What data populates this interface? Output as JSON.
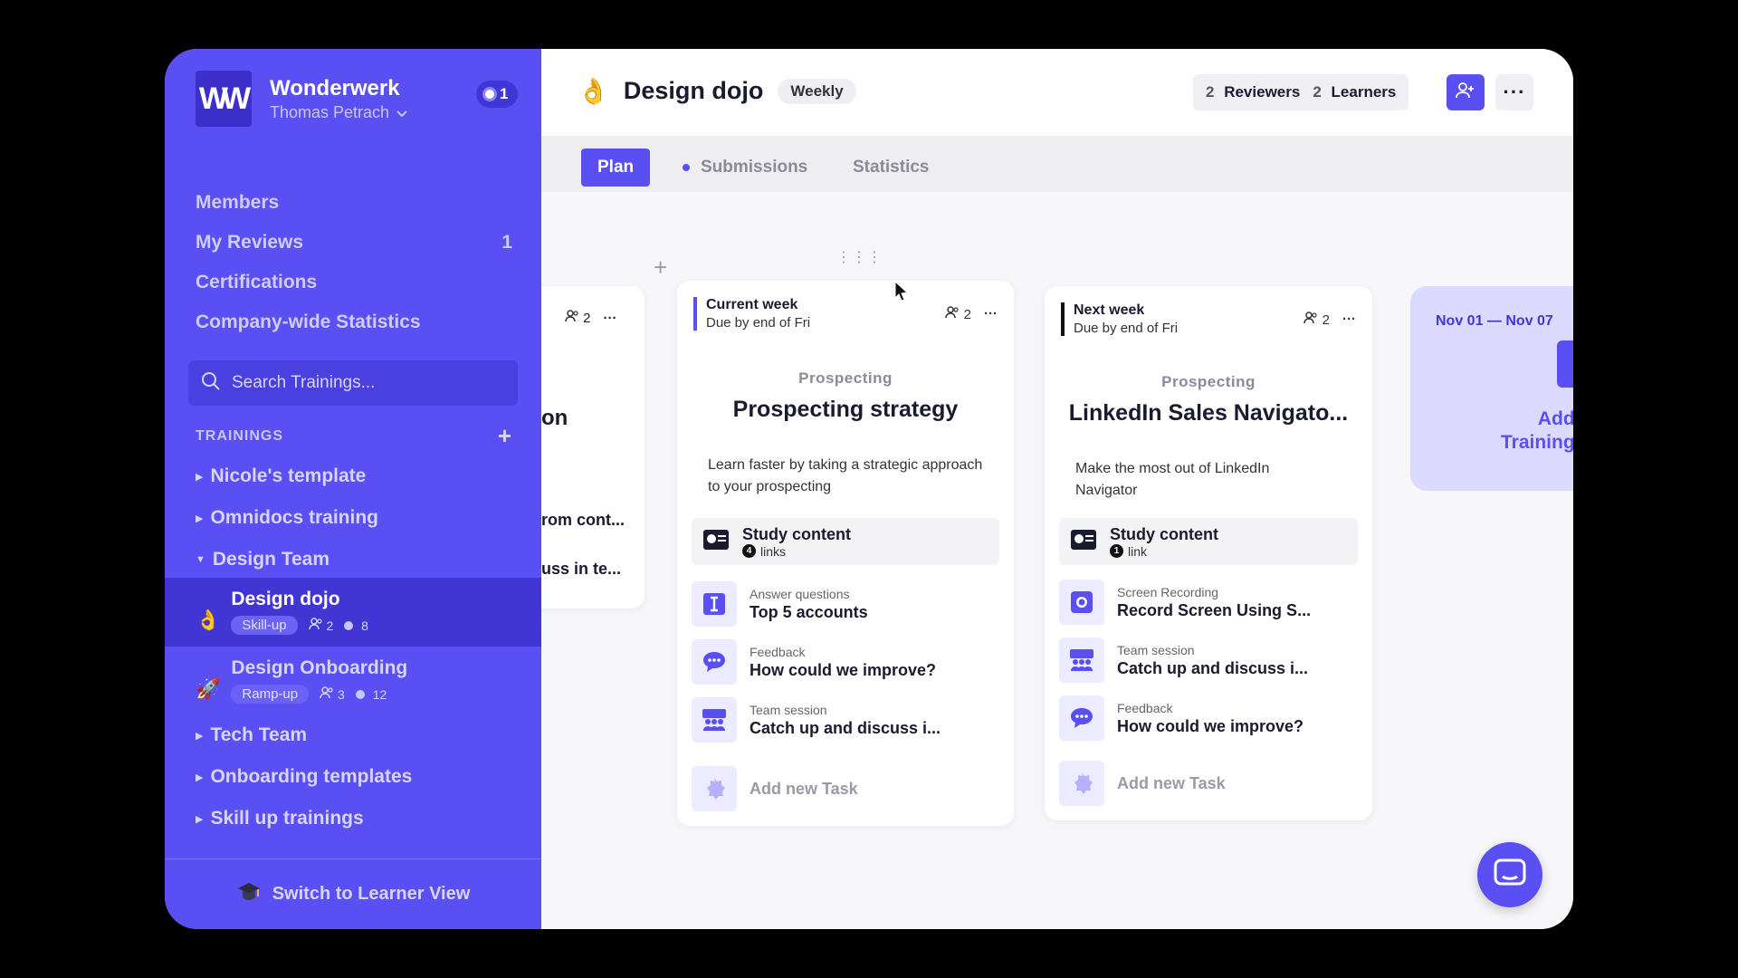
{
  "sidebar": {
    "logo_text": "W",
    "org_name": "Wonderwerk",
    "user_name": "Thomas Petrach",
    "notification_count": "1",
    "nav": [
      {
        "label": "Members",
        "count": ""
      },
      {
        "label": "My Reviews",
        "count": "1"
      },
      {
        "label": "Certifications",
        "count": ""
      },
      {
        "label": "Company-wide Statistics",
        "count": ""
      }
    ],
    "search_placeholder": "Search Trainings...",
    "trainings_header": "TRAININGS",
    "tree": {
      "nicole": "Nicole's template",
      "omnidocs": "Omnidocs training",
      "design_team": "Design Team",
      "tech_team": "Tech Team",
      "onboarding": "Onboarding templates",
      "skillup": "Skill up trainings"
    },
    "trainings": [
      {
        "emoji": "👌",
        "title": "Design dojo",
        "tag": "Skill-up",
        "members": "2",
        "items": "8"
      },
      {
        "emoji": "🚀",
        "title": "Design Onboarding",
        "tag": "Ramp-up",
        "members": "3",
        "items": "12"
      }
    ],
    "footer_label": "Switch to Learner View"
  },
  "header": {
    "emoji": "👌",
    "title": "Design dojo",
    "frequency": "Weekly",
    "reviewers_count": "2",
    "reviewers_label": "Reviewers",
    "learners_count": "2",
    "learners_label": "Learners"
  },
  "tabs": [
    "Plan",
    "Submissions",
    "Statistics"
  ],
  "partial_card": {
    "members": "2",
    "title_fragment": "on",
    "line1": "rom cont...",
    "line2": "uss in te..."
  },
  "cards": [
    {
      "week": "Current week",
      "due": "Due by end of Fri",
      "members": "2",
      "category": "Prospecting",
      "title": "Prospecting strategy",
      "description": "Learn faster by taking a strategic approach to your prospecting",
      "study_title": "Study content",
      "study_count": "4",
      "study_unit": "links",
      "tasks": [
        {
          "kind": "Answer questions",
          "name": "Top 5 accounts",
          "icon": "text-cursor-icon"
        },
        {
          "kind": "Feedback",
          "name": "How could we improve?",
          "icon": "chat-bubble-icon"
        },
        {
          "kind": "Team session",
          "name": "Catch up and discuss i...",
          "icon": "team-icon"
        }
      ],
      "add_task": "Add new Task"
    },
    {
      "week": "Next week",
      "due": "Due by end of Fri",
      "members": "2",
      "category": "Prospecting",
      "title": "LinkedIn Sales Navigato...",
      "description": "Make the most out of LinkedIn Navigator",
      "study_title": "Study content",
      "study_count": "1",
      "study_unit": "link",
      "tasks": [
        {
          "kind": "Screen Recording",
          "name": "Record Screen Using S...",
          "icon": "record-icon"
        },
        {
          "kind": "Team session",
          "name": "Catch up and discuss i...",
          "icon": "team-icon"
        },
        {
          "kind": "Feedback",
          "name": "How could we improve?",
          "icon": "chat-bubble-icon"
        }
      ],
      "add_task": "Add new Task"
    }
  ],
  "ghost_card": {
    "date_range": "Nov 01 — Nov 07",
    "add_text_1": "Add",
    "add_text_2": "Training"
  },
  "colors": {
    "brand": "#5a4ff2",
    "brand_dark": "#4136d3",
    "background": "#f7f7f9"
  }
}
